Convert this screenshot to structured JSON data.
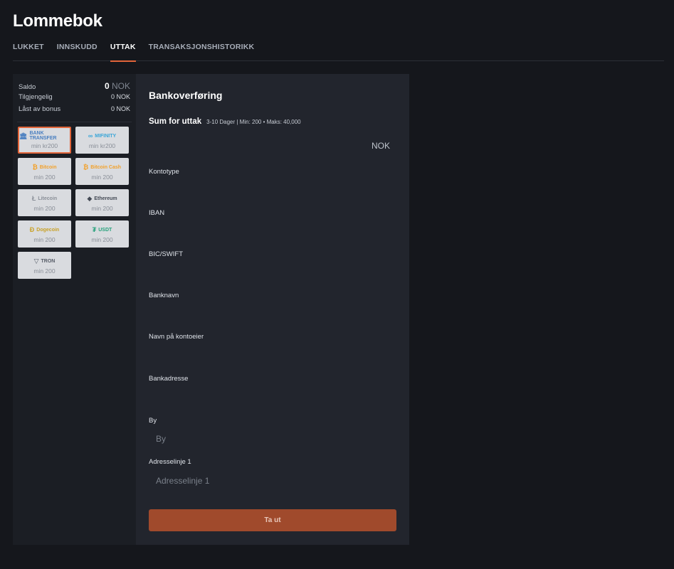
{
  "page": {
    "title": "Lommebok"
  },
  "tabs": [
    {
      "label": "LUKKET",
      "active": false
    },
    {
      "label": "INNSKUDD",
      "active": false
    },
    {
      "label": "UTTAK",
      "active": true
    },
    {
      "label": "TRANSAKSJONSHISTORIKK",
      "active": false
    }
  ],
  "balance": {
    "saldo_label": "Saldo",
    "saldo_value": "0",
    "saldo_currency": "NOK",
    "available_label": "Tilgjengelig",
    "available_value": "0 NOK",
    "locked_label": "Låst av bonus",
    "locked_value": "0 NOK"
  },
  "methods": [
    {
      "name": "BANK TRANSFER",
      "icon": "bank-icon",
      "glyph": "🏛",
      "color": "#4a7fc0",
      "min": "min kr200",
      "selected": true
    },
    {
      "name": "MIFINITY",
      "icon": "mifinity-icon",
      "glyph": "∞",
      "color": "#3aa6d8",
      "min": "min kr200",
      "selected": false
    },
    {
      "name": "Bitcoin",
      "icon": "bitcoin-icon",
      "glyph": "₿",
      "color": "#f2a12b",
      "min": "min 200",
      "selected": false
    },
    {
      "name": "Bitcoin Cash",
      "icon": "bitcoin-cash-icon",
      "glyph": "₿",
      "color": "#f2a12b",
      "min": "min 200",
      "selected": false
    },
    {
      "name": "Litecoin",
      "icon": "litecoin-icon",
      "glyph": "Ł",
      "color": "#8a8f98",
      "min": "min 200",
      "selected": false
    },
    {
      "name": "Ethereum",
      "icon": "ethereum-icon",
      "glyph": "◆",
      "color": "#444a55",
      "min": "min 200",
      "selected": false
    },
    {
      "name": "Dogecoin",
      "icon": "dogecoin-icon",
      "glyph": "Ð",
      "color": "#c9a227",
      "min": "min 200",
      "selected": false
    },
    {
      "name": "USDT",
      "icon": "tether-icon",
      "glyph": "₮",
      "color": "#26a17b",
      "min": "min 200",
      "selected": false
    },
    {
      "name": "TRON",
      "icon": "tron-icon",
      "glyph": "▽",
      "color": "#555b66",
      "min": "min 200",
      "selected": false
    }
  ],
  "withdrawal": {
    "heading": "Bankoverføring",
    "sum_label": "Sum for uttak",
    "sum_hint": "3-10 Dager | Min: 200 • Maks: 40,000",
    "currency": "NOK",
    "fields": {
      "account_type": {
        "label": "Kontotype",
        "placeholder": ""
      },
      "iban": {
        "label": "IBAN",
        "placeholder": ""
      },
      "bic": {
        "label": "BIC/SWIFT",
        "placeholder": ""
      },
      "bank_name": {
        "label": "Banknavn",
        "placeholder": ""
      },
      "owner_name": {
        "label": "Navn på kontoeier",
        "placeholder": ""
      },
      "bank_address": {
        "label": "Bankadresse",
        "placeholder": ""
      },
      "city": {
        "label": "By",
        "placeholder": "By"
      },
      "address1": {
        "label": "Adresselinje 1",
        "placeholder": "Adresselinje 1"
      }
    },
    "submit_label": "Ta ut"
  },
  "colors": {
    "accent": "#e2653a",
    "button": "#a04a2c"
  }
}
